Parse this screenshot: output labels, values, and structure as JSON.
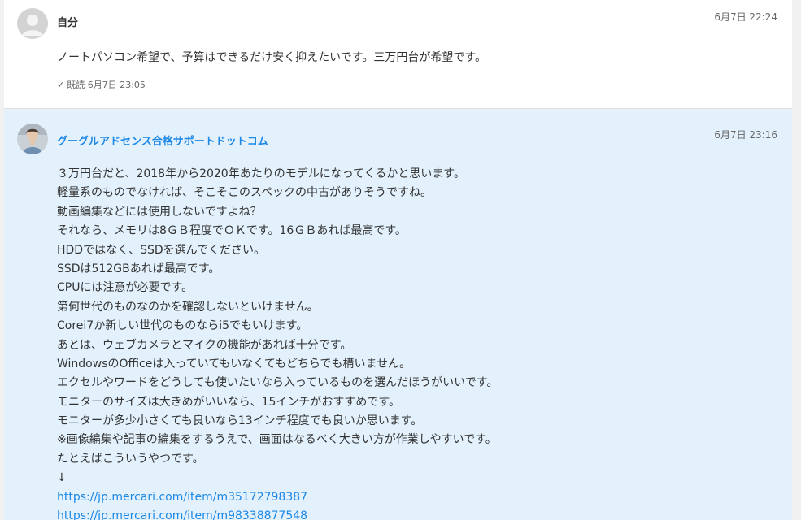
{
  "self_message": {
    "sender": "自分",
    "time": "6月7日 22:24",
    "text": "ノートパソコン希望で、予算はできるだけ安く抑えたいです。三万円台が希望です。",
    "read_check": "✓",
    "read_status": "既読 6月7日 23:05"
  },
  "reply_message": {
    "sender": "グーグルアドセンス合格サポートドットコム",
    "time": "6月7日 23:16",
    "lines": [
      "３万円台だと、2018年から2020年あたりのモデルになってくるかと思います。",
      "軽量系のものでなければ、そこそこのスペックの中古がありそうですね。",
      "動画編集などには使用しないですよね？",
      "それなら、メモリは8ＧＢ程度でＯＫです。16ＧＢあれば最高です。",
      "HDDではなく、SSDを選んでください。",
      "SSDは512GBあれば最高です。",
      "CPUには注意が必要です。",
      "第何世代のものなのかを確認しないといけません。",
      "Corei7か新しい世代のものならi5でもいけます。",
      "あとは、ウェブカメラとマイクの機能があれば十分です。",
      "WindowsのOfficeは入っていてもいなくてもどちらでも構いません。",
      "エクセルやワードをどうしても使いたいなら入っているものを選んだほうがいいです。",
      "モニターのサイズは大きめがいいなら、15インチがおすすめです。",
      "モニターが多少小さくても良いなら13インチ程度でも良いか思います。",
      "※画像編集や記事の編集をするうえで、画面はなるべく大きい方が作業しやすいです。",
      "たとえばこういうやつです。",
      "↓"
    ],
    "links": [
      "https://jp.mercari.com/item/m35172798387",
      "https://jp.mercari.com/item/m98338877548"
    ]
  },
  "colors": {
    "reply_background": "#e3f1fc",
    "link": "#1e88e5"
  }
}
